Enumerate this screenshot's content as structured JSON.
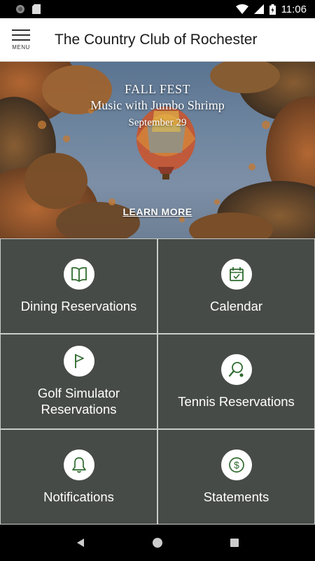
{
  "status_bar": {
    "time": "11:06"
  },
  "app_bar": {
    "menu_label": "MENU",
    "title": "The Country Club of Rochester"
  },
  "hero": {
    "title": "FALL FEST",
    "subtitle": "Music with Jumbo Shrimp",
    "date": "September 29",
    "cta": "LEARN MORE"
  },
  "tiles": [
    {
      "label": "Dining Reservations",
      "icon": "book-icon"
    },
    {
      "label": "Calendar",
      "icon": "calendar-icon"
    },
    {
      "label": "Golf Simulator Reservations",
      "icon": "golf-flag-icon"
    },
    {
      "label": "Tennis Reservations",
      "icon": "tennis-racket-icon"
    },
    {
      "label": "Notifications",
      "icon": "bell-icon"
    },
    {
      "label": "Statements",
      "icon": "dollar-icon"
    }
  ],
  "colors": {
    "tile_bg": "#474b47",
    "icon_green": "#2f6b2f",
    "grid_line": "#c9ccc9"
  }
}
